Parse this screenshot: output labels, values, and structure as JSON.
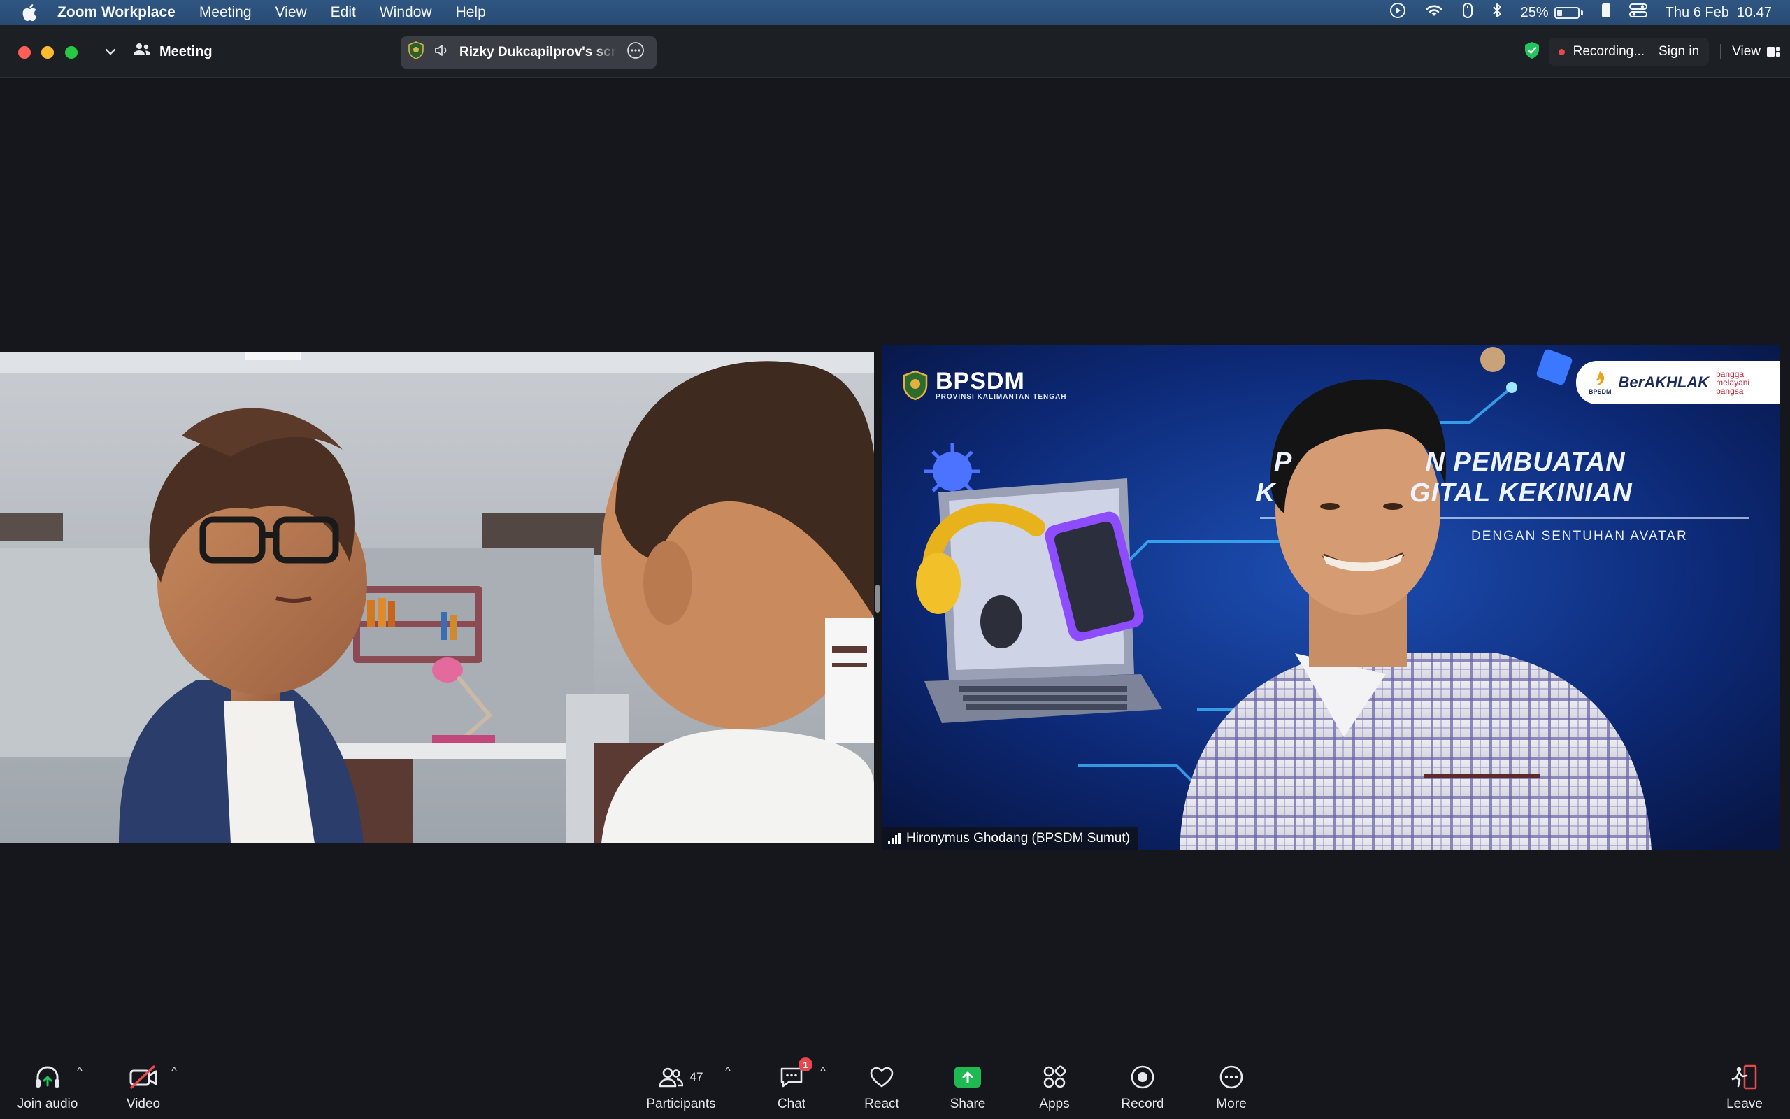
{
  "menubar": {
    "app_name": "Zoom Workplace",
    "items": [
      "Meeting",
      "View",
      "Edit",
      "Window",
      "Help"
    ],
    "battery_percent": "25%",
    "battery_level": 0.25,
    "datetime": "Thu 6 Feb  10.47"
  },
  "titlebar": {
    "meeting_label": "Meeting",
    "share_source": "Rizky Dukcapilprov's screen",
    "recording_label": "Recording...",
    "sign_in_label": "Sign in",
    "view_label": "View"
  },
  "tiles": {
    "right": {
      "participant_name": "Hironymus Ghodang (BPSDM Sumut)",
      "slide": {
        "org_name": "BPSDM",
        "org_subtitle": "PROVINSI KALIMANTAN TENGAH",
        "badge_text": "BerAKHLAK",
        "badge_side": "bangga melayani bangsa",
        "badge_small": "BPSDM",
        "title_line1_left": "P",
        "title_line1_right": "N PEMBUATAN",
        "title_line2_left": "K",
        "title_line2_right": "GITAL KEKINIAN",
        "subtitle": "DENGAN SENTUHAN AVATAR"
      }
    }
  },
  "toolbar": {
    "join_audio": "Join audio",
    "video": "Video",
    "participants": "Participants",
    "participants_count": "47",
    "chat": "Chat",
    "chat_badge": "1",
    "react": "React",
    "share": "Share",
    "apps": "Apps",
    "record": "Record",
    "more": "More",
    "leave": "Leave"
  },
  "colors": {
    "menubar_bg": "#2b4f79",
    "window_bg": "#15171c",
    "share_green": "#1fb954",
    "recording_red": "#e5484d",
    "slide_bg": "#0a1a4c"
  }
}
